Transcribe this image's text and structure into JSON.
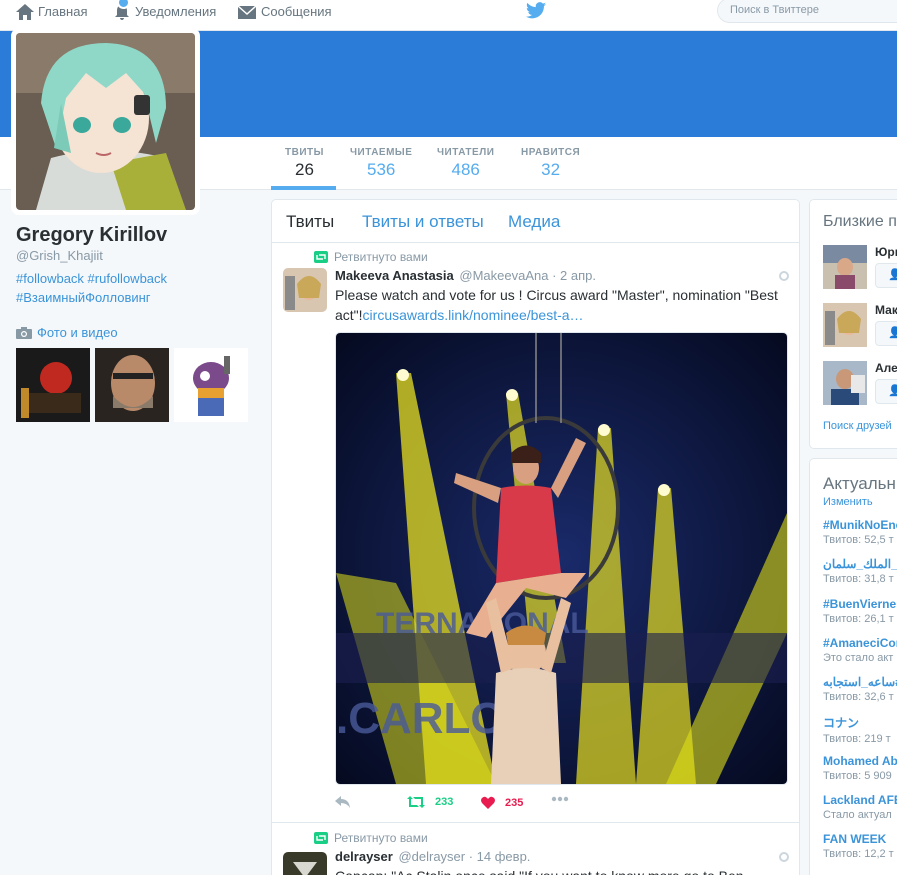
{
  "nav": {
    "home": "Главная",
    "notifications": "Уведомления",
    "messages": "Сообщения",
    "search_placeholder": "Поиск в Твиттере",
    "accent": "#55acee"
  },
  "profile": {
    "name": "Gregory Kirillov",
    "handle": "@Grish_Khajiit",
    "bio_line1": "#followback #rufollowback",
    "bio_line2": "#ВзаимныйФолловинг",
    "photos_label": "Фото и видео",
    "banner_color": "#2b7bd9"
  },
  "stats": [
    {
      "label": "ТВИТЫ",
      "value": "26"
    },
    {
      "label": "ЧИТАЕМЫЕ",
      "value": "536"
    },
    {
      "label": "ЧИТАТЕЛИ",
      "value": "486"
    },
    {
      "label": "НРАВИТСЯ",
      "value": "32"
    }
  ],
  "tabs": [
    "Твиты",
    "Твиты и ответы",
    "Медиа"
  ],
  "tweets": [
    {
      "retweet_label": "Ретвитнуто вами",
      "name": "Makeeva Anastasia",
      "handle": "@MakeevaAna · 2 апр.",
      "text": "Please watch and vote for us ! Circus award \"Master\", nomination \"Best act\"!",
      "link": "circusawards.link/nominee/best-a…",
      "retweets": "233",
      "likes": "235"
    },
    {
      "retweet_label": "Ретвитнуто вами",
      "name": "delrayser",
      "handle": "@delrayser · 14 февр.",
      "text": "Сарсар: \"Ас Stalin once said \"If you want to know more go to Ben"
    }
  ],
  "sidebar": {
    "suggest_title": "Близкие п",
    "suggestions": [
      {
        "name": "Юри"
      },
      {
        "name": "Мак"
      },
      {
        "name": "Але"
      }
    ],
    "find_friends": "Поиск друзей",
    "trends_title": "Актуальны",
    "change_label": "Изменить",
    "trends": [
      {
        "tag": "#MunikNoEnc",
        "sub": "Твитов: 52,5 т"
      },
      {
        "tag": "شكرا_الملك_سلمان#",
        "sub": "Твитов: 31,8 т"
      },
      {
        "tag": "#BuenVierne",
        "sub": "Твитов: 26,1 т"
      },
      {
        "tag": "#AmaneciCor",
        "sub": "Это стало акт"
      },
      {
        "tag": "ساعه_استجابه#",
        "sub": "Твитов: 32,6 т"
      },
      {
        "tag": "コナン",
        "sub": "Твитов: 219 т"
      },
      {
        "tag": "Mohamed Ab",
        "sub": "Твитов: 5 909"
      },
      {
        "tag": "Lackland AFE",
        "sub": "Стало актуал"
      },
      {
        "tag": "FAN WEEK",
        "sub": "Твитов: 12,2 т"
      }
    ]
  }
}
